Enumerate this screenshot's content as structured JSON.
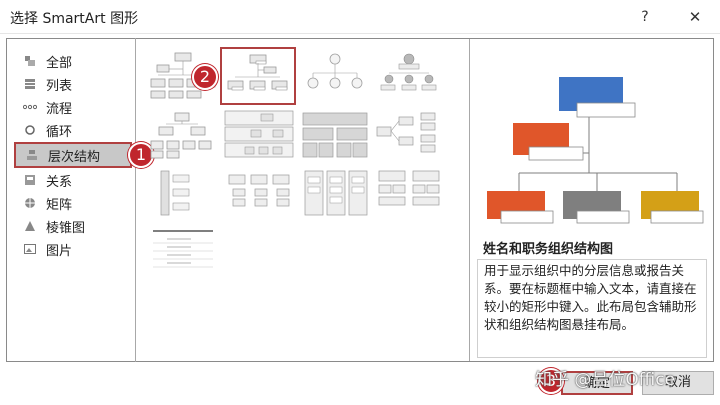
{
  "window": {
    "title": "选择 SmartArt 图形",
    "help_glyph": "?",
    "close_glyph": "✕"
  },
  "categories": [
    {
      "label": "全部",
      "icon": "all-icon"
    },
    {
      "label": "列表",
      "icon": "list-icon"
    },
    {
      "label": "流程",
      "icon": "process-icon"
    },
    {
      "label": "循环",
      "icon": "cycle-icon"
    },
    {
      "label": "层次结构",
      "icon": "hierarchy-icon",
      "selected": true
    },
    {
      "label": "关系",
      "icon": "relationship-icon"
    },
    {
      "label": "矩阵",
      "icon": "matrix-icon"
    },
    {
      "label": "棱锥图",
      "icon": "pyramid-icon"
    },
    {
      "label": "图片",
      "icon": "picture-icon"
    }
  ],
  "badges": {
    "one": "1",
    "two": "2",
    "three": "3"
  },
  "preview": {
    "title": "姓名和职务组织结构图",
    "description": "用于显示组织中的分层信息或报告关系。要在标题框中输入文本，请直接在较小的矩形中键入。此布局包含辅助形状和组织结构图悬挂布局。"
  },
  "buttons": {
    "ok": "确定",
    "cancel": "取消"
  },
  "watermark": "知乎 @吕位Office",
  "colors": {
    "accent_red": "#c0262d",
    "blue": "#3f74c4",
    "orange": "#e0562a",
    "gray": "#7f7f7f",
    "gold": "#d4a017"
  }
}
